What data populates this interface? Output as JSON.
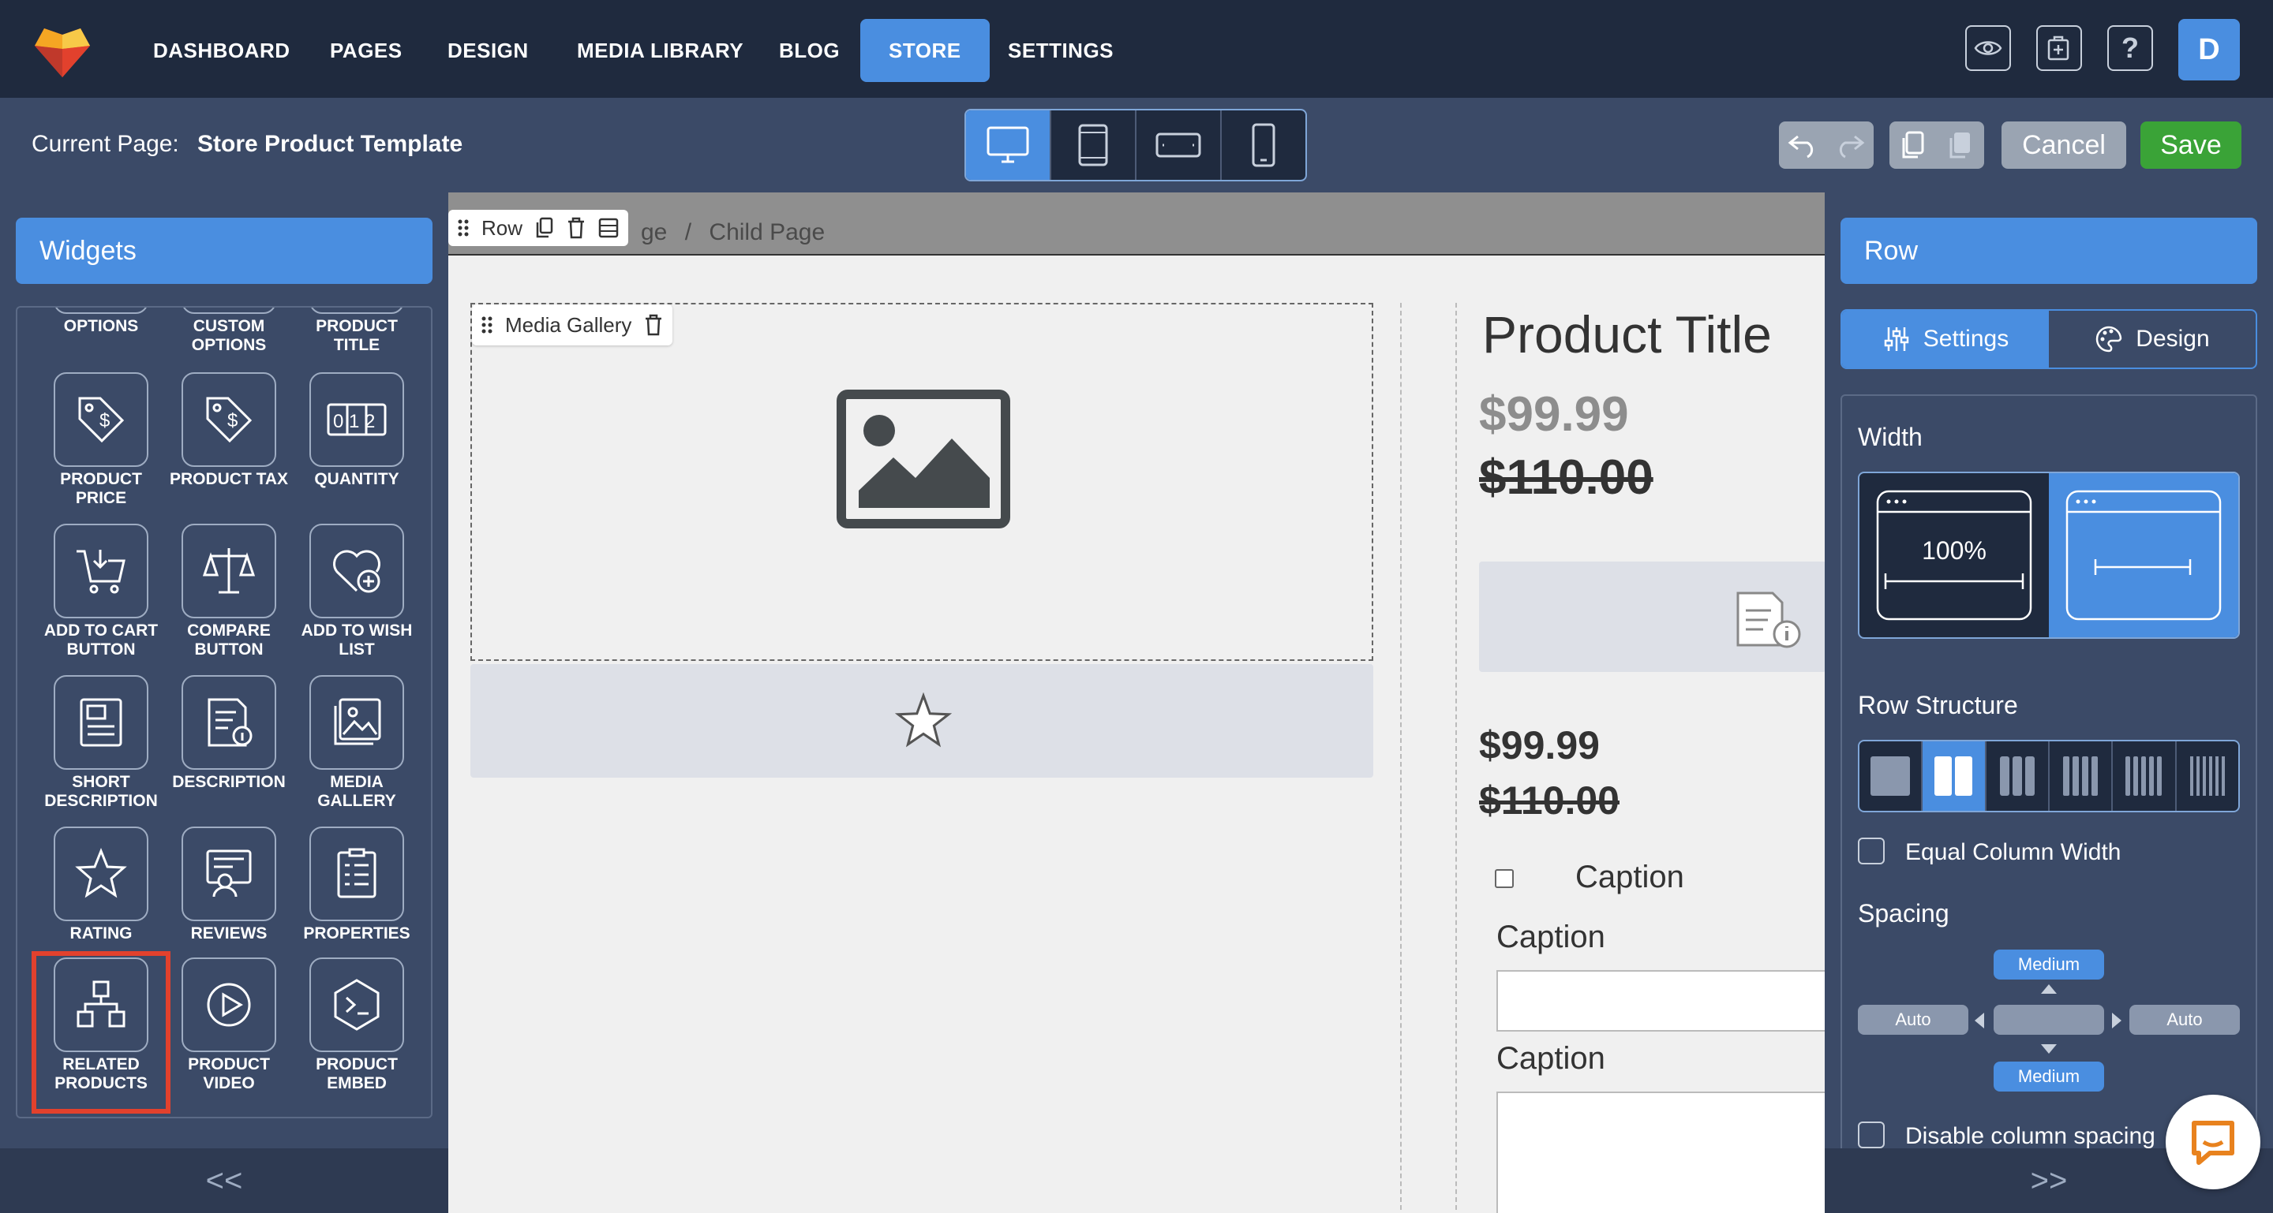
{
  "nav": {
    "items": [
      "DASHBOARD",
      "PAGES",
      "DESIGN",
      "MEDIA LIBRARY",
      "BLOG",
      "STORE",
      "SETTINGS"
    ],
    "active": "STORE",
    "avatar": "D"
  },
  "subbar": {
    "current_page_label": "Current Page:",
    "current_page_value": "Store Product Template",
    "cancel_label": "Cancel",
    "save_label": "Save"
  },
  "widgets": {
    "title": "Widgets",
    "items": [
      {
        "label": "OPTIONS",
        "icon": "options-icon"
      },
      {
        "label": "CUSTOM OPTIONS",
        "icon": "custom-options-icon"
      },
      {
        "label": "PRODUCT TITLE",
        "icon": "product-title-icon"
      },
      {
        "label": "PRODUCT PRICE",
        "icon": "price-tag-icon"
      },
      {
        "label": "PRODUCT TAX",
        "icon": "tax-tag-icon"
      },
      {
        "label": "QUANTITY",
        "icon": "quantity-icon"
      },
      {
        "label": "ADD TO CART BUTTON",
        "icon": "cart-icon"
      },
      {
        "label": "COMPARE BUTTON",
        "icon": "scale-icon"
      },
      {
        "label": "ADD TO WISH LIST",
        "icon": "heart-plus-icon"
      },
      {
        "label": "SHORT DESCRIPTION",
        "icon": "short-description-icon"
      },
      {
        "label": "DESCRIPTION",
        "icon": "description-icon"
      },
      {
        "label": "MEDIA GALLERY",
        "icon": "media-gallery-icon"
      },
      {
        "label": "RATING",
        "icon": "star-icon"
      },
      {
        "label": "REVIEWS",
        "icon": "reviews-icon"
      },
      {
        "label": "PROPERTIES",
        "icon": "properties-icon"
      },
      {
        "label": "RELATED PRODUCTS",
        "icon": "related-products-icon"
      },
      {
        "label": "PRODUCT VIDEO",
        "icon": "play-icon"
      },
      {
        "label": "PRODUCT EMBED",
        "icon": "embed-icon"
      }
    ],
    "collapse": "<<"
  },
  "canvas": {
    "breadcrumb_partial": "ge",
    "breadcrumb_sep": "/",
    "breadcrumb_child": "Child Page",
    "row_tool_label": "Row",
    "media_gallery_label": "Media Gallery",
    "product_title": "Product Title",
    "price": "$99.99",
    "old_price": "$110.00",
    "price_2": "$99.99",
    "old_price_2": "$110.00",
    "caption_checkbox": "Caption",
    "caption_input": "Caption",
    "caption_textarea": "Caption"
  },
  "rightpanel": {
    "title": "Row",
    "tab_settings": "Settings",
    "tab_design": "Design",
    "width_label": "Width",
    "width_full_text": "100%",
    "row_structure_label": "Row Structure",
    "equal_width_label": "Equal Column Width",
    "spacing_label": "Spacing",
    "spacing_top": "Medium",
    "spacing_bottom": "Medium",
    "spacing_left": "Auto",
    "spacing_right": "Auto",
    "disable_spacing_label": "Disable column spacing",
    "collapse": ">>"
  },
  "colors": {
    "accent": "#4a8ee0",
    "save": "#3aa337",
    "highlight": "#e2412d"
  }
}
